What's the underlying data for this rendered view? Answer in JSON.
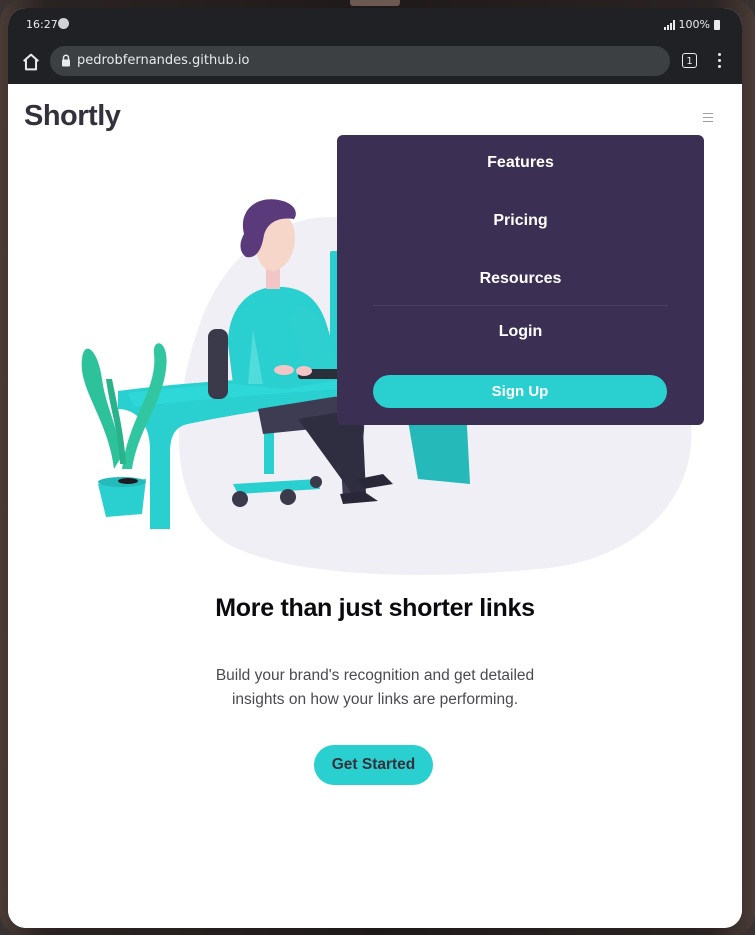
{
  "status_bar": {
    "time": "16:27",
    "battery": "100%"
  },
  "browser": {
    "url": "pedrobfernandes.github.io",
    "tab_count": "1"
  },
  "site": {
    "logo": "Shortly",
    "nav": {
      "items": [
        "Features",
        "Pricing",
        "Resources",
        "Login"
      ],
      "signup_label": "Sign Up"
    },
    "hero": {
      "headline": "More than just shorter links",
      "subtext": "Build your brand's recognition and get detailed insights on how your links are performing.",
      "cta_label": "Get Started"
    }
  },
  "icons": [
    "home-icon",
    "lock-icon",
    "tabs-icon",
    "menu-dots-icon",
    "hamburger-icon",
    "signal-icon",
    "battery-icon"
  ],
  "colors": {
    "brand_cyan": "#2acfcf",
    "menu_purple": "#3b3054",
    "dark_text": "#34313d",
    "toolbar_dark": "#202124"
  }
}
